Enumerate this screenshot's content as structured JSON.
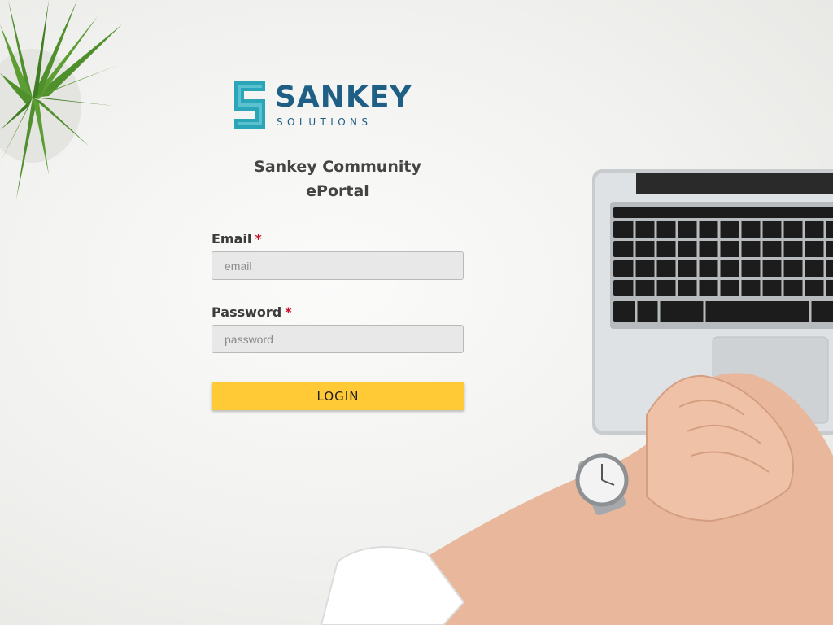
{
  "brand": {
    "name": "SANKEY",
    "tagline": "SOLUTIONS",
    "color": "#1f5f86",
    "mark_color": "#2aa6b8"
  },
  "portal": {
    "title_line1": "Sankey Community",
    "title_line2": "ePortal"
  },
  "form": {
    "email": {
      "label": "Email",
      "required_mark": "*",
      "placeholder": "email",
      "value": ""
    },
    "password": {
      "label": "Password",
      "required_mark": "*",
      "placeholder": "password",
      "value": ""
    },
    "login_label": "LOGIN"
  },
  "colors": {
    "button": "#ffca35",
    "required": "#c8102e",
    "input_bg": "#e8e8e8"
  },
  "background_icons": [
    "plant-icon",
    "laptop-icon",
    "arm-with-watch-icon"
  ]
}
